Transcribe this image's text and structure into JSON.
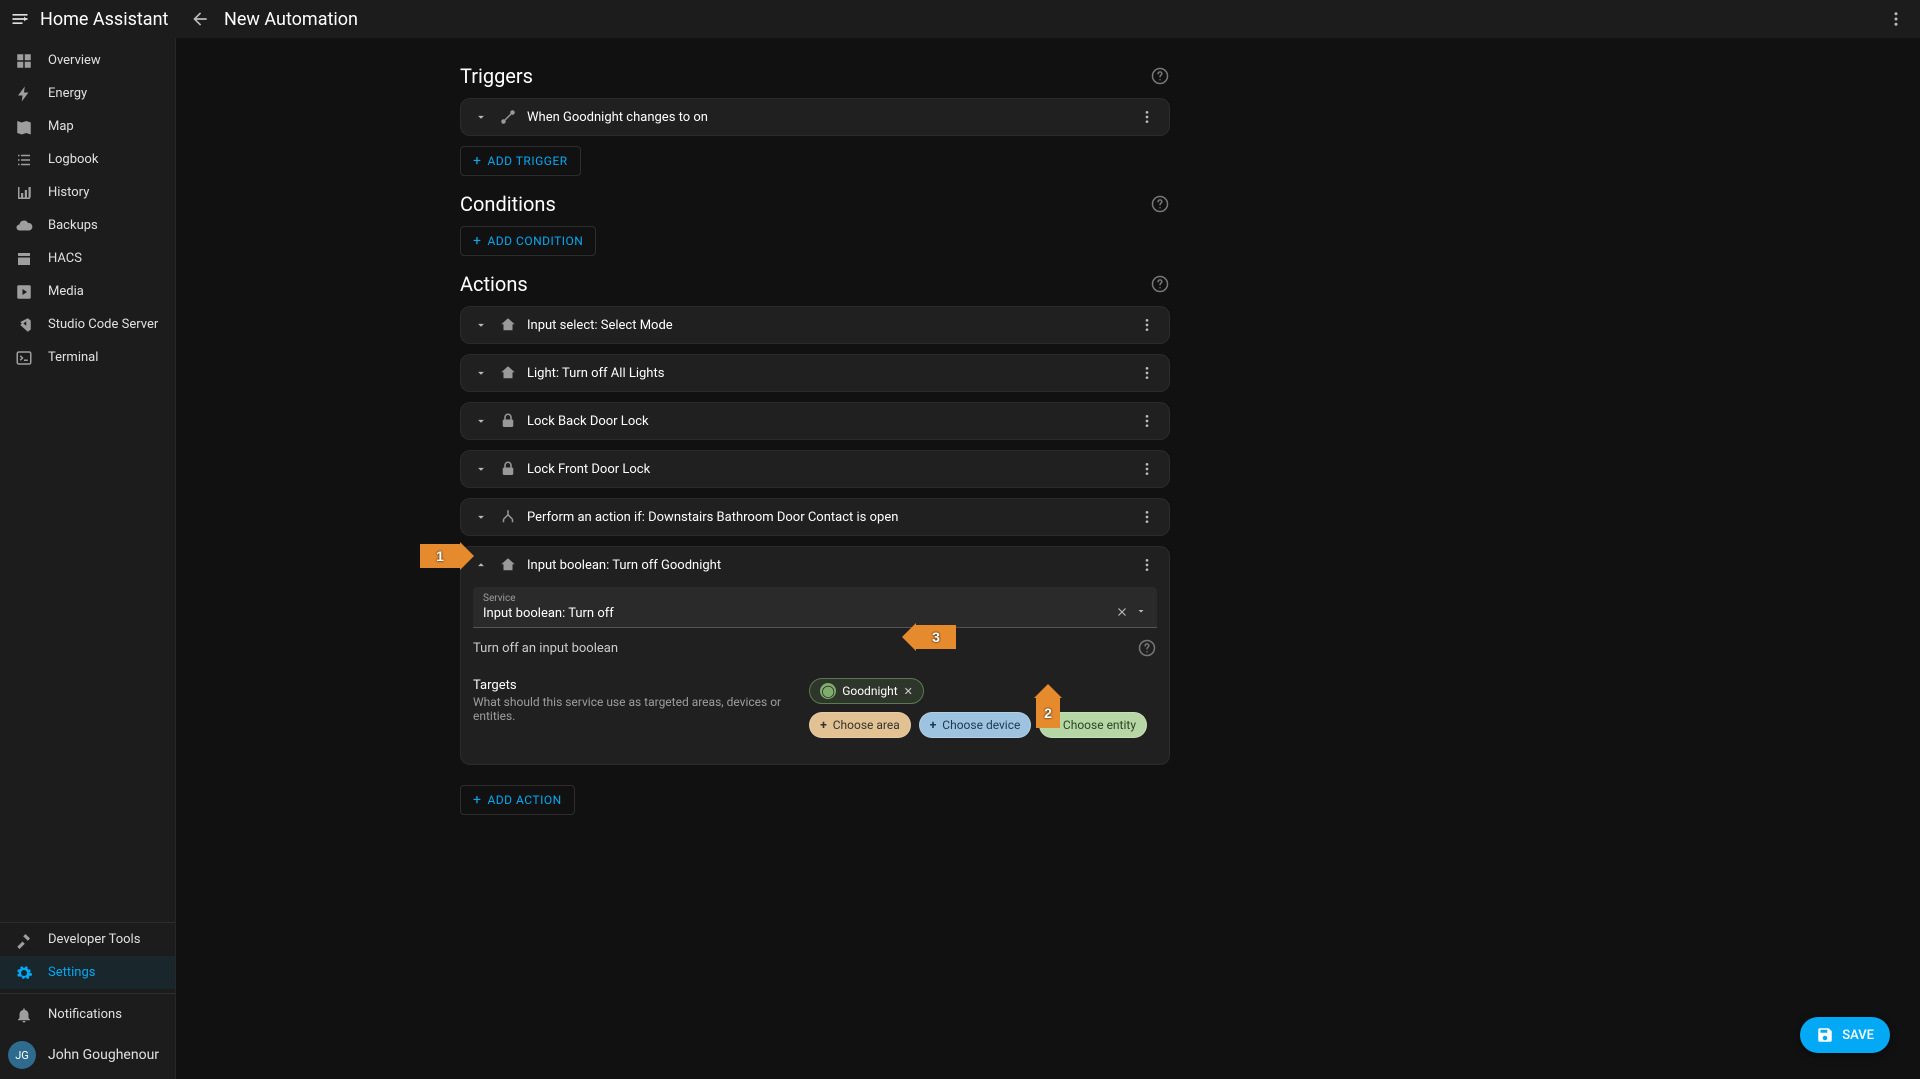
{
  "app": {
    "title": "Home Assistant",
    "page_title": "New Automation"
  },
  "sidebar": {
    "items": [
      {
        "label": "Overview",
        "icon": "dashboard"
      },
      {
        "label": "Energy",
        "icon": "bolt"
      },
      {
        "label": "Map",
        "icon": "map"
      },
      {
        "label": "Logbook",
        "icon": "list"
      },
      {
        "label": "History",
        "icon": "chart"
      },
      {
        "label": "Backups",
        "icon": "cloud"
      },
      {
        "label": "HACS",
        "icon": "store"
      },
      {
        "label": "Media",
        "icon": "play"
      },
      {
        "label": "Studio Code Server",
        "icon": "vscode"
      },
      {
        "label": "Terminal",
        "icon": "terminal"
      }
    ],
    "dev_tools": "Developer Tools",
    "settings": "Settings",
    "notifications": "Notifications",
    "user": {
      "initials": "JG",
      "name": "John Goughenour"
    }
  },
  "sections": {
    "triggers": "Triggers",
    "conditions": "Conditions",
    "actions": "Actions"
  },
  "triggers": [
    {
      "title": "When Goodnight changes to on"
    }
  ],
  "buttons": {
    "add_trigger": "ADD TRIGGER",
    "add_condition": "ADD CONDITION",
    "add_action": "ADD ACTION",
    "save": "SAVE"
  },
  "actions": [
    {
      "title": "Input select: Select Mode",
      "icon": "ha"
    },
    {
      "title": "Light: Turn off All Lights",
      "icon": "ha"
    },
    {
      "title": "Lock Back Door Lock",
      "icon": "lock"
    },
    {
      "title": "Lock Front Door Lock",
      "icon": "lock"
    },
    {
      "title": "Perform an action if: Downstairs Bathroom Door Contact is open",
      "icon": "branch"
    }
  ],
  "expanded_action": {
    "title": "Input boolean: Turn off Goodnight",
    "service_label": "Service",
    "service_value": "Input boolean: Turn off",
    "service_desc": "Turn off an input boolean",
    "targets_title": "Targets",
    "targets_sub": "What should this service use as targeted areas, devices or entities.",
    "selected_entity": "Goodnight",
    "choose_area": "Choose area",
    "choose_device": "Choose device",
    "choose_entity": "Choose entity"
  },
  "annotations": {
    "a1": "1",
    "a2": "2",
    "a3": "3"
  }
}
